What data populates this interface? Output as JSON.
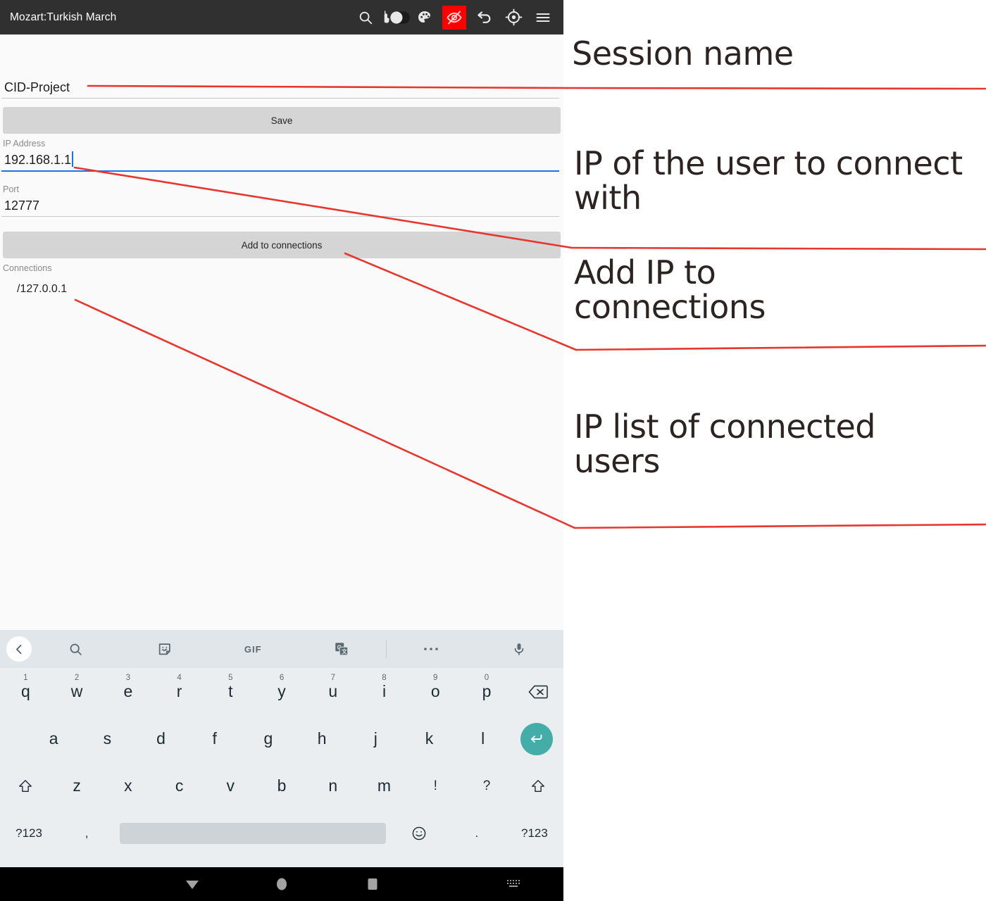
{
  "appbar": {
    "title": "Mozart:Turkish March",
    "actions": [
      {
        "icon": "search-icon",
        "label": "Search"
      },
      {
        "icon": "touch-toggle-icon",
        "label": "Touch mode toggle"
      },
      {
        "icon": "palette-icon",
        "label": "Palette"
      },
      {
        "icon": "eye-off-icon",
        "label": "Hide",
        "color": "#ff0000",
        "active": true
      },
      {
        "icon": "undo-icon",
        "label": "Undo"
      },
      {
        "icon": "crosshair-icon",
        "label": "Locate"
      },
      {
        "icon": "hamburger-menu-icon",
        "label": "Menu"
      }
    ]
  },
  "form": {
    "session_name": {
      "value": "CID-Project",
      "placeholder": "Session name"
    },
    "save_button": "Save",
    "ip_address": {
      "label": "IP Address",
      "value": "192.168.1.1",
      "placeholder": "IP Address",
      "focused": true
    },
    "port": {
      "label": "Port",
      "value": "12777",
      "placeholder": "Port"
    },
    "add_button": "Add to connections",
    "connections": {
      "label": "Connections",
      "items": [
        "/127.0.0.1"
      ]
    }
  },
  "keyboard": {
    "toolbar": [
      {
        "icon": "chevron-left-icon",
        "label": "Back"
      },
      {
        "icon": "search-icon",
        "label": "Search"
      },
      {
        "icon": "sticker-icon",
        "label": "Stickers"
      },
      {
        "icon": "gif-icon",
        "label": "GIF"
      },
      {
        "icon": "translate-icon",
        "label": "Translate"
      },
      {
        "icon": "divider",
        "label": ""
      },
      {
        "icon": "more-horizontal-icon",
        "label": "More"
      },
      {
        "icon": "microphone-icon",
        "label": "Voice input"
      }
    ],
    "row1": [
      {
        "key": "q",
        "num": "1"
      },
      {
        "key": "w",
        "num": "2"
      },
      {
        "key": "e",
        "num": "3"
      },
      {
        "key": "r",
        "num": "4"
      },
      {
        "key": "t",
        "num": "5"
      },
      {
        "key": "y",
        "num": "6"
      },
      {
        "key": "u",
        "num": "7"
      },
      {
        "key": "i",
        "num": "8"
      },
      {
        "key": "o",
        "num": "9"
      },
      {
        "key": "p",
        "num": "0"
      }
    ],
    "backspace": "backspace-icon",
    "row2": [
      "a",
      "s",
      "d",
      "f",
      "g",
      "h",
      "j",
      "k",
      "l"
    ],
    "enter": "enter-icon",
    "row3": [
      "z",
      "x",
      "c",
      "v",
      "b",
      "n",
      "m",
      "!",
      "?"
    ],
    "shift_left": "shift-icon",
    "shift_right": "shift-icon",
    "row4": {
      "symbols_left": "?123",
      "comma": ",",
      "space": "",
      "emoji": "emoji-icon",
      "period": ".",
      "symbols_right": "?123"
    }
  },
  "navbar": [
    {
      "icon": "back-triangle-icon",
      "label": "Back"
    },
    {
      "icon": "home-circle-icon",
      "label": "Home"
    },
    {
      "icon": "recents-square-icon",
      "label": "Recents"
    },
    {
      "icon": "keyboard-indicator-icon",
      "label": "Keyboard active"
    }
  ],
  "annotations": {
    "accent_color": "#e8352e",
    "items": [
      {
        "text": "Session name"
      },
      {
        "text": "IP of the user to connect with"
      },
      {
        "text": "Add IP to connections"
      },
      {
        "text": "IP list of connected users"
      }
    ]
  }
}
